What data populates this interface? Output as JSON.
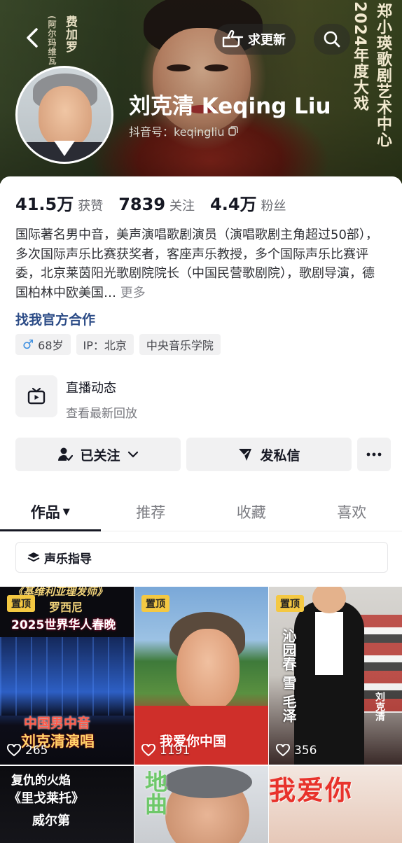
{
  "header": {
    "banner_vertical_left_big": "费加罗",
    "banner_vertical_left_small": "(阿尔玛维瓦",
    "banner_vertical_right_1": "郑小瑛歌剧艺术中心",
    "banner_vertical_right_2": "2024年度大戏",
    "update_label": "求更新"
  },
  "profile": {
    "name": "刘克清 Keqing Liu",
    "handle_label": "抖音号：keqingliu",
    "stats": [
      {
        "num": "41.5万",
        "label": "获赞"
      },
      {
        "num": "7839",
        "label": "关注"
      },
      {
        "num": "4.4万",
        "label": "粉丝"
      }
    ],
    "bio": "国际著名男中音，美声演唱歌剧演员（演唱歌剧主角超过50部），多次国际声乐比赛获奖者，客座声乐教授，多个国际声乐比赛评委，北京莱茵阳光歌剧院院长（中国民营歌剧院），歌剧导演，德国柏林中欧美国…",
    "bio_more": "更多",
    "coop_link": "找我官方合作",
    "tags": {
      "age": "68岁",
      "ip": "IP：北京",
      "school": "中央音乐学院"
    }
  },
  "live": {
    "title": "直播动态",
    "subtitle": "查看最新回放"
  },
  "actions": {
    "follow_label": "已关注",
    "message_label": "发私信"
  },
  "tabs": [
    {
      "label": "作品"
    },
    {
      "label": "推荐"
    },
    {
      "label": "收藏"
    },
    {
      "label": "喜欢"
    }
  ],
  "filter": {
    "label": "声乐指导"
  },
  "videos": [
    {
      "pinned": "置顶",
      "likes": "265",
      "overlay_1": "《基维利亚理发师》",
      "overlay_2": "罗西尼",
      "overlay_3": "2025世界华人春晚",
      "overlay_4": "中国男中音",
      "overlay_5": "刘克清演唱"
    },
    {
      "pinned": "置顶",
      "likes": "1191",
      "overlay_1": "我爱你中国"
    },
    {
      "pinned": "置顶",
      "likes": "356",
      "overlay_1": "沁园春 雪 毛泽",
      "overlay_2": "刘克清"
    },
    {
      "overlay_1": "复仇的火焰",
      "overlay_2": "《里戈莱托》",
      "overlay_3": "威尔第"
    },
    {
      "overlay_1": "地曲"
    },
    {
      "overlay_1": "我爱你"
    }
  ],
  "colors": {
    "link": "#2b4b86",
    "pin_badge": "#f4c842",
    "male_icon": "#3b8ee0"
  }
}
